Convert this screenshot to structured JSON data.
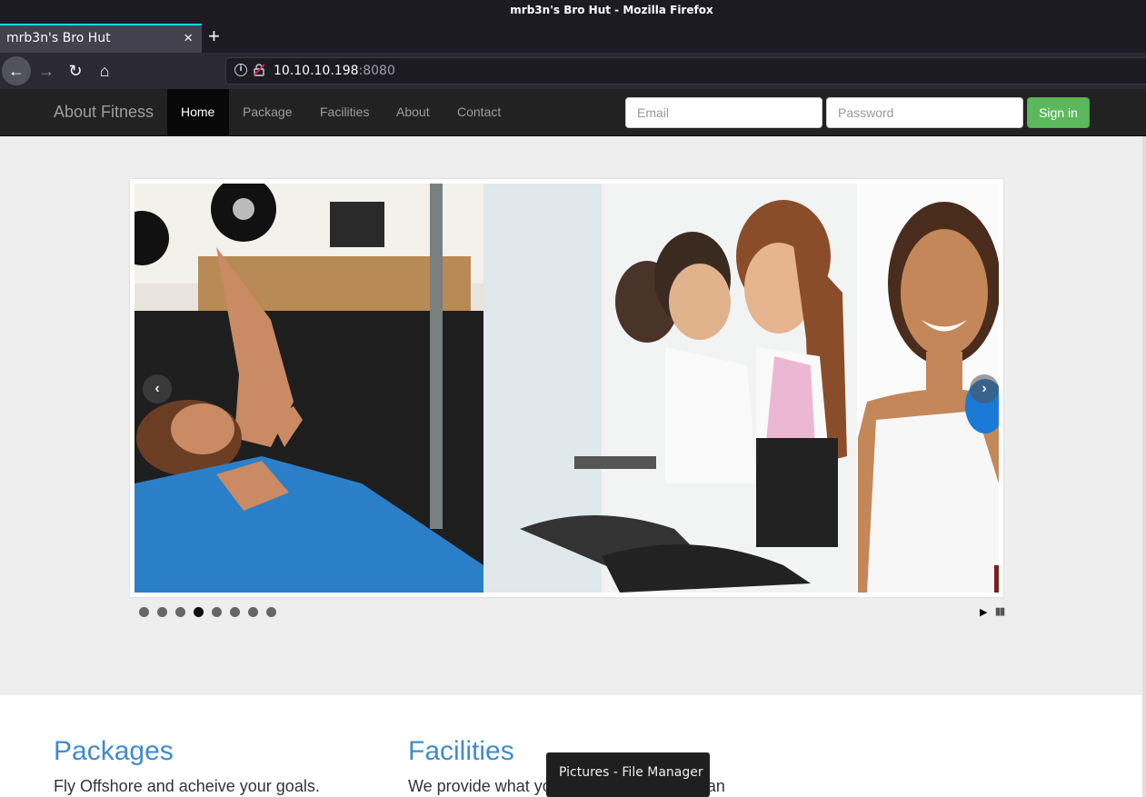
{
  "window": {
    "title": "mrb3n's Bro Hut - Mozilla Firefox"
  },
  "tab": {
    "label": "mrb3n's Bro Hut",
    "close": "×",
    "new": "+"
  },
  "nav": {
    "back": "←",
    "forward": "→",
    "reload": "↻",
    "home": "⌂"
  },
  "urlbar": {
    "info": "i",
    "host": "10.10.10.198",
    "port": ":8080"
  },
  "site": {
    "brand": "About Fitness",
    "menu": [
      {
        "label": "Home",
        "active": true
      },
      {
        "label": "Package"
      },
      {
        "label": "Facilities"
      },
      {
        "label": "About"
      },
      {
        "label": "Contact"
      }
    ],
    "email_placeholder": "Email",
    "password_placeholder": "Password",
    "signin_label": "Sign in"
  },
  "slider": {
    "prev_icon": "‹",
    "next_icon": "›",
    "dots_total": 8,
    "active_dot": 4,
    "play_icon": "▶",
    "pause_icon": "▮▮"
  },
  "sections": {
    "packages": {
      "title": "Packages",
      "text": "Fly Offshore and acheive your goals."
    },
    "facilities": {
      "title": "Facilities",
      "text": "We provide what you need to be better than"
    }
  },
  "tooltip": {
    "text": "Pictures - File Manager"
  },
  "colors": {
    "accent": "#428bca",
    "signin": "#5cb85c",
    "navbar": "#222222",
    "tab_highlight": "#00ddff"
  }
}
